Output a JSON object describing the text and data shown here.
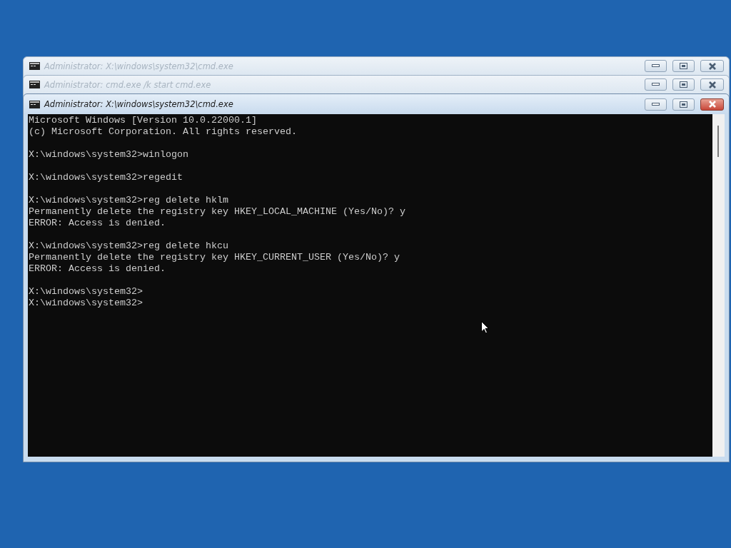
{
  "windows": [
    {
      "title": "Administrator: X:\\windows\\system32\\cmd.exe",
      "active": false
    },
    {
      "title": "Administrator: cmd.exe /k start cmd.exe",
      "active": false
    },
    {
      "title": "Administrator: X:\\windows\\system32\\cmd.exe",
      "active": true
    }
  ],
  "console": {
    "blocks": [
      [
        "Microsoft Windows [Version 10.0.22000.1]",
        "(c) Microsoft Corporation. All rights reserved."
      ],
      [
        "X:\\windows\\system32>winlogon"
      ],
      [
        "X:\\windows\\system32>regedit"
      ],
      [
        "X:\\windows\\system32>reg delete hklm",
        "Permanently delete the registry key HKEY_LOCAL_MACHINE (Yes/No)? y",
        "ERROR: Access is denied."
      ],
      [
        "X:\\windows\\system32>reg delete hkcu",
        "Permanently delete the registry key HKEY_CURRENT_USER (Yes/No)? y",
        "ERROR: Access is denied."
      ],
      [
        "X:\\windows\\system32>",
        "X:\\windows\\system32>"
      ]
    ]
  }
}
